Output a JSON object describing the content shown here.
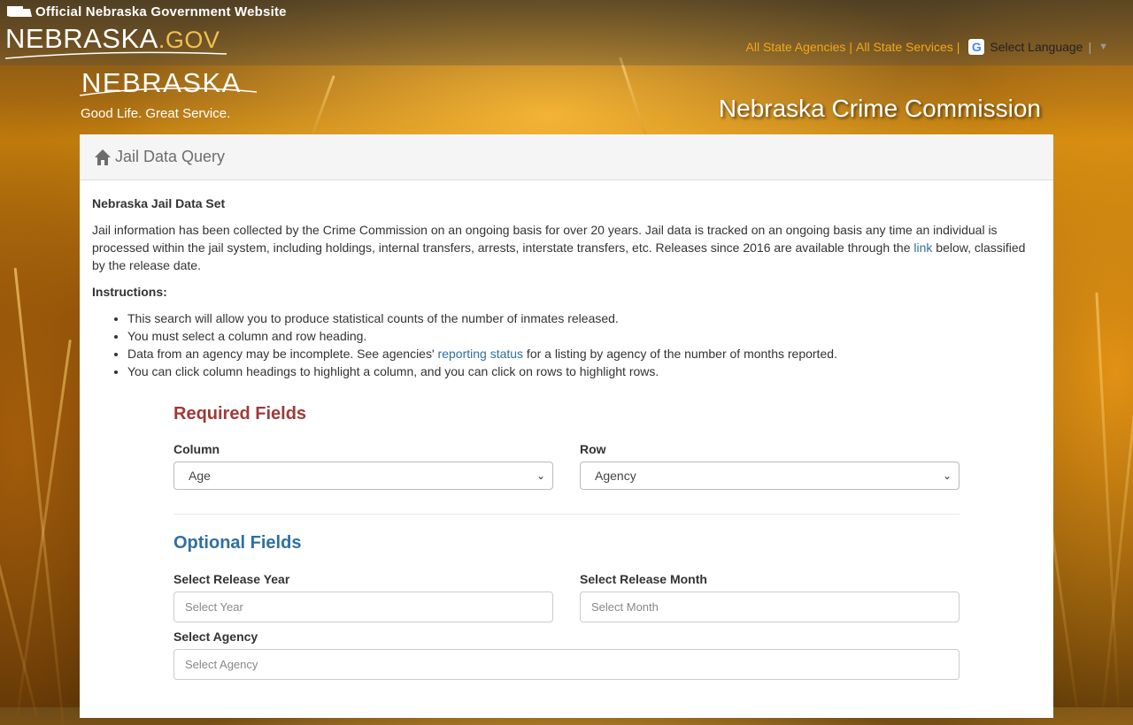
{
  "header": {
    "official_text": "Official Nebraska Government Website",
    "portal_name": "NEBRASKA",
    "portal_suffix": ".GOV",
    "links": {
      "all_agencies": "All State Agencies",
      "all_services": "All State Services",
      "separator": "|"
    },
    "language": {
      "icon": "google-translate-icon",
      "label": "Select Language"
    }
  },
  "brand": {
    "name": "NEBRASKA",
    "tagline": "Good Life. Great Service.",
    "agency_title": "Nebraska Crime Commission"
  },
  "panel": {
    "header_icon": "home-icon",
    "title": "Jail Data Query",
    "dataset_title": "Nebraska Jail Data Set",
    "intro_part1": "Jail information has been collected by the Crime Commission on an ongoing basis for over 20 years. Jail data is tracked on an ongoing basis any time an individual is processed within the jail system, including holdings, internal transfers, arrests, interstate transfers, etc. Releases since 2016 are available through the ",
    "intro_link": "link",
    "intro_part2": " below, classified by the release date.",
    "instructions_title": "Instructions:",
    "instructions": {
      "i0": "This search will allow you to produce statistical counts of the number of inmates released.",
      "i1": "You must select a column and row heading.",
      "i2_part1": "Data from an agency may be incomplete. See agencies' ",
      "i2_link": "reporting status",
      "i2_part2": " for a listing by agency of the number of months reported.",
      "i3": "You can click column headings to highlight a column, and you can click on rows to highlight rows."
    }
  },
  "form": {
    "required_title": "Required Fields",
    "column": {
      "label": "Column",
      "selected": "Age"
    },
    "row": {
      "label": "Row",
      "selected": "Agency"
    },
    "optional_title": "Optional Fields",
    "release_year": {
      "label": "Select Release Year",
      "placeholder": "Select Year"
    },
    "release_month": {
      "label": "Select Release Month",
      "placeholder": "Select Month"
    },
    "agency": {
      "label": "Select Agency",
      "placeholder": "Select Agency"
    }
  },
  "colors": {
    "link": "#2f6fa3",
    "required_title": "#9e3a3a",
    "top_links": "#f0a818"
  }
}
